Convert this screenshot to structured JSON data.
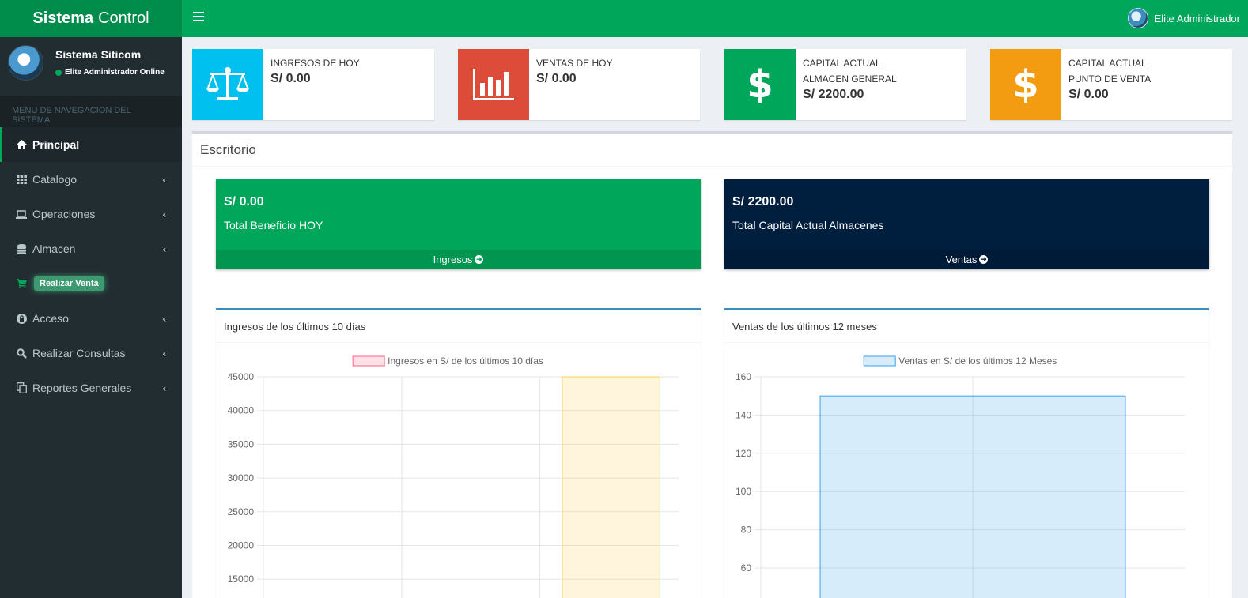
{
  "header": {
    "logo_bold": "Sistema",
    "logo_light": "Control",
    "user_name": "Elite Administrador"
  },
  "sidebar": {
    "user_name": "Sistema Siticom",
    "user_status": "Elite Administrador Online",
    "menu_header": "MENU DE NAVEGACION DEL SISTEMA",
    "items": [
      {
        "label": "Principal",
        "icon": "home-icon"
      },
      {
        "label": "Catalogo",
        "icon": "grid-icon"
      },
      {
        "label": "Operaciones",
        "icon": "laptop-icon"
      },
      {
        "label": "Almacen",
        "icon": "database-icon"
      },
      {
        "label": "Realizar Venta",
        "icon": "cart-icon"
      },
      {
        "label": "Acceso",
        "icon": "lock-icon"
      },
      {
        "label": "Realizar Consultas",
        "icon": "search-icon"
      },
      {
        "label": "Reportes Generales",
        "icon": "copy-icon"
      }
    ]
  },
  "info_boxes": [
    {
      "label1": "INGRESOS DE HOY",
      "label2": "",
      "value": "S/ 0.00",
      "color": "#00c0ef",
      "icon": "balance-scale-icon"
    },
    {
      "label1": "VENTAS DE HOY",
      "label2": "",
      "value": "S/ 0.00",
      "color": "#dd4b39",
      "icon": "bar-chart-icon"
    },
    {
      "label1": "CAPITAL ACTUAL",
      "label2": "ALMACEN GENERAL",
      "value": "S/ 2200.00",
      "color": "#00a65a",
      "icon": "dollar-icon",
      "symbol": "$"
    },
    {
      "label1": "CAPITAL ACTUAL",
      "label2": "PUNTO DE VENTA",
      "value": "S/ 0.00",
      "color": "#f39c12",
      "icon": "dollar-icon",
      "symbol": "$"
    }
  ],
  "main": {
    "title": "Escritorio",
    "summary": [
      {
        "value": "S/ 0.00",
        "label": "Total Beneficio HOY",
        "footer": "Ingresos",
        "color": "#00a65a"
      },
      {
        "value": "S/ 2200.00",
        "label": "Total Capital Actual Almacenes",
        "footer": "Ventas",
        "color": "#001f3f"
      }
    ],
    "arrow_glyph": "➜"
  },
  "chart_data": [
    {
      "type": "bar",
      "title": "Ingresos de los últimos 10 días",
      "legend": "Ingresos en S/ de los últimos 10 días",
      "categories": [
        "",
        "",
        ""
      ],
      "values": [
        0,
        0,
        45000
      ],
      "yticks": [
        "45000",
        "40000",
        "35000",
        "30000",
        "25000",
        "20000",
        "15000"
      ],
      "ylim": [
        15000,
        45000
      ],
      "grid": true
    },
    {
      "type": "bar",
      "title": "Ventas de los últimos 12 meses",
      "legend": "Ventas en S/ de los últimos 12 Meses",
      "categories": [
        ""
      ],
      "values": [
        150
      ],
      "yticks": [
        "160",
        "140",
        "120",
        "100",
        "80",
        "60"
      ],
      "ylim": [
        60,
        160
      ],
      "grid": true
    }
  ]
}
